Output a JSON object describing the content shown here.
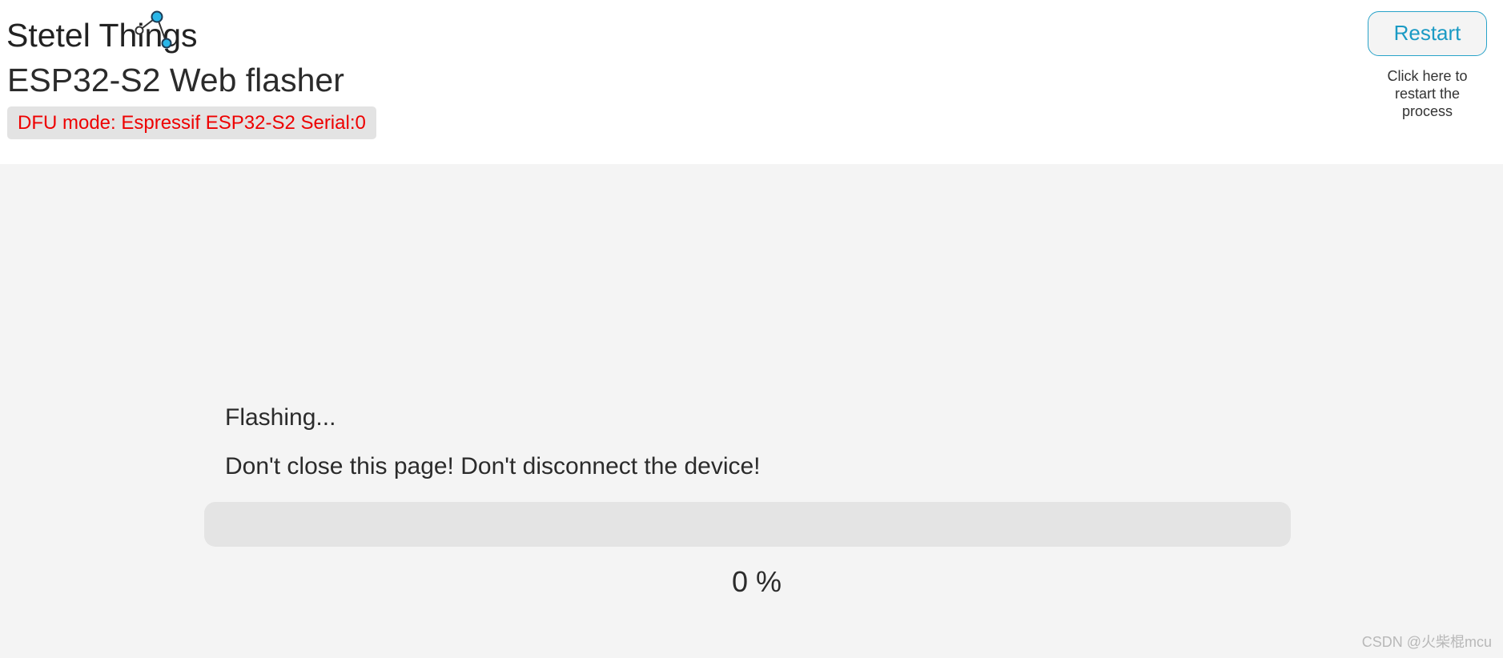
{
  "header": {
    "brand": "Stetel Things",
    "logo_icon": "network-nodes-icon",
    "app_title": "ESP32-S2 Web flasher",
    "dfu_status": "DFU mode: Espressif ESP32-S2 Serial:0"
  },
  "restart": {
    "label": "Restart",
    "hint": "Click here to restart the process"
  },
  "status": {
    "title": "Flashing...",
    "warning": "Don't close this page! Don't disconnect the device!"
  },
  "progress": {
    "value": 0,
    "text": "0 %"
  },
  "watermark": "CSDN @火柴棍mcu",
  "colors": {
    "accent": "#29a3c9",
    "error_text": "#ee0000",
    "page_bg": "#f4f4f4",
    "header_bg": "#ffffff",
    "track_bg": "#e4e4e4"
  }
}
